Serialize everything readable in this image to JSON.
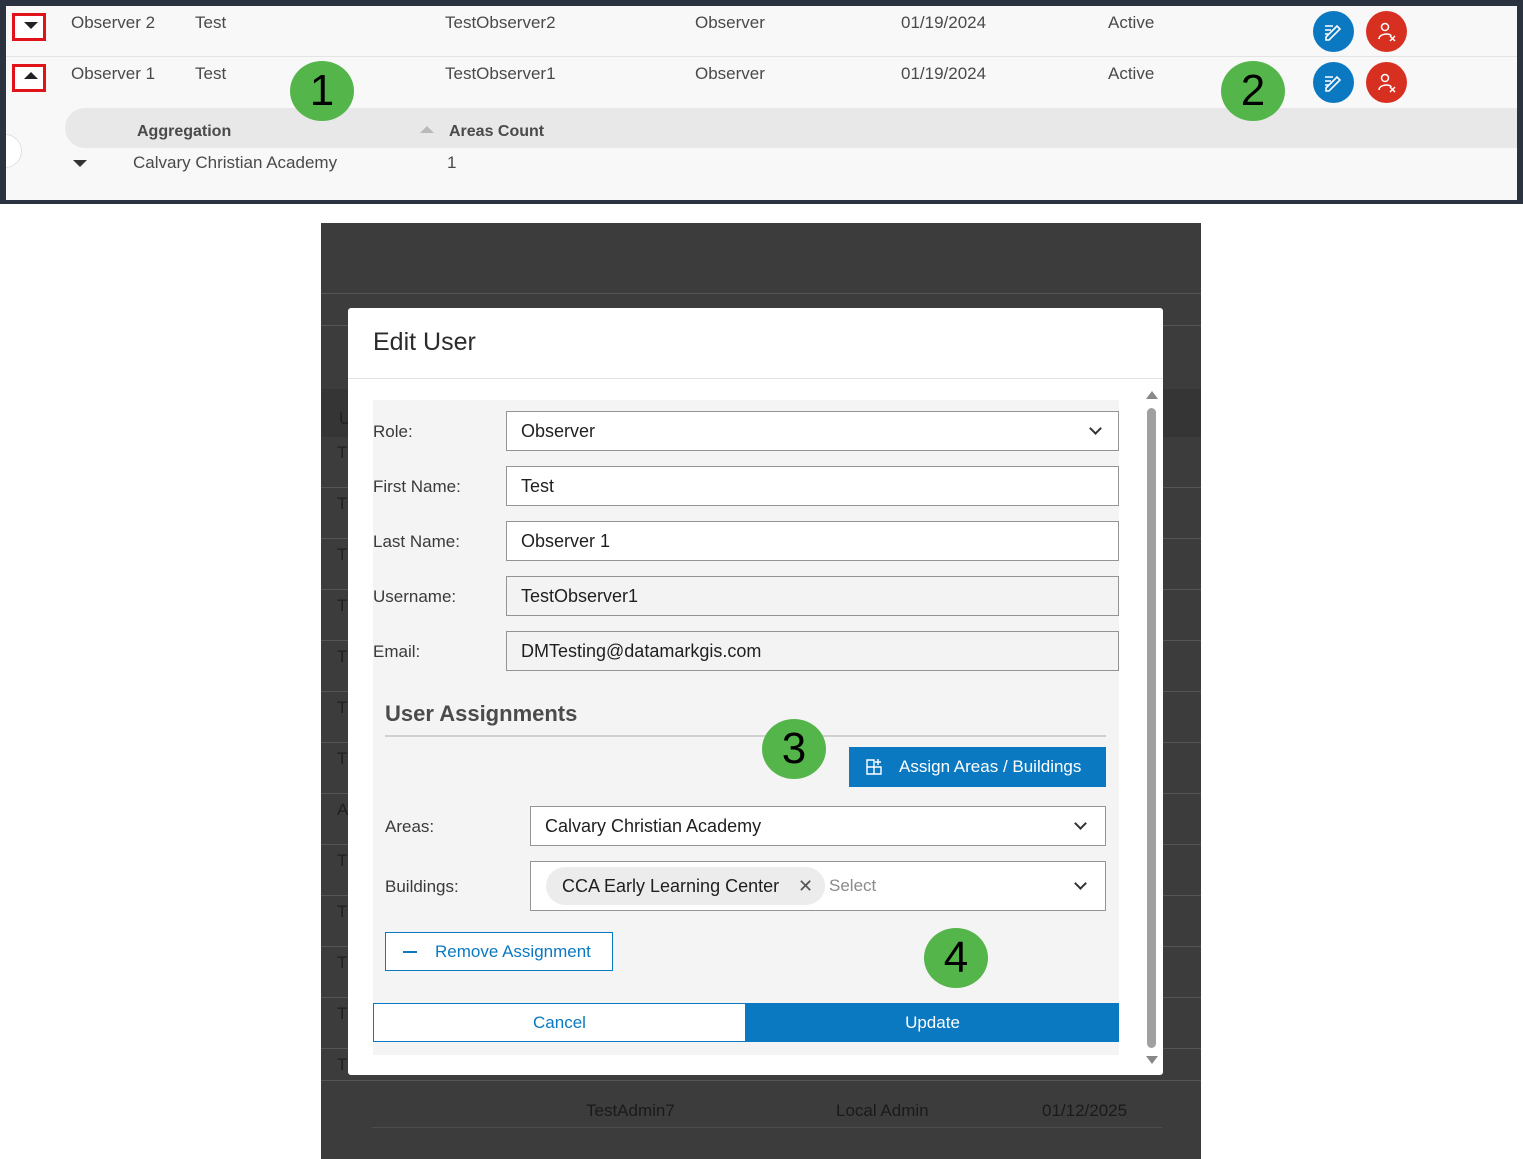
{
  "table": {
    "rows": [
      {
        "name": "Observer 2",
        "first": "Test",
        "username": "TestObserver2",
        "role": "Observer",
        "date": "01/19/2024",
        "status": "Active"
      },
      {
        "name": "Observer 1",
        "first": "Test",
        "username": "TestObserver1",
        "role": "Observer",
        "date": "01/19/2024",
        "status": "Active"
      }
    ],
    "subtable": {
      "col_aggregation": "Aggregation",
      "col_areas": "Areas Count",
      "row_name": "Calvary Christian Academy",
      "row_count": "1"
    }
  },
  "badges": {
    "b1": "1",
    "b2": "2",
    "b3": "3",
    "b4": "4"
  },
  "background_list": {
    "letters": [
      "U",
      "T",
      "T",
      "T",
      "T",
      "T",
      "T",
      "T",
      "A",
      "T",
      "T",
      "T",
      "T",
      "T"
    ],
    "last_row": {
      "username": "TestAdmin7",
      "role": "Local Admin",
      "date": "01/12/2025"
    }
  },
  "dialog": {
    "title": "Edit User",
    "role_label": "Role:",
    "role_value": "Observer",
    "first_label": "First Name:",
    "first_value": "Test",
    "last_label": "Last Name:",
    "last_value": "Observer 1",
    "username_label": "Username:",
    "username_value": "TestObserver1",
    "email_label": "Email:",
    "email_value": "DMTesting@datamarkgis.com",
    "assignments_title": "User Assignments",
    "assign_button": "Assign Areas / Buildings",
    "areas_label": "Areas:",
    "areas_value": "Calvary Christian Academy",
    "buildings_label": "Buildings:",
    "buildings_chip": "CCA Early Learning Center",
    "buildings_placeholder": "Select",
    "remove_button": "Remove Assignment",
    "cancel_button": "Cancel",
    "update_button": "Update"
  },
  "colors": {
    "primary": "#0a79c1",
    "danger": "#d83020",
    "badge": "#54b64a",
    "highlight_border": "#e0121a"
  }
}
